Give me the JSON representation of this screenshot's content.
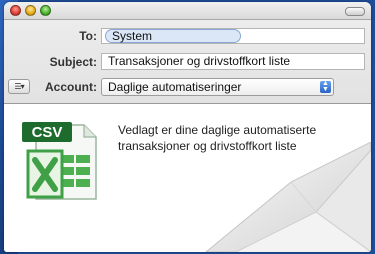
{
  "header": {
    "to_label": "To:",
    "to_recipient": "System",
    "subject_label": "Subject:",
    "subject_value": "Transaksjoner og drivstoffkort liste",
    "account_label": "Account:",
    "account_value": "Daglige automatiseringer"
  },
  "attachment": {
    "icon_text": "CSV"
  },
  "message": {
    "text": "Vedlagt er dine daglige automatiserte transaksjoner og drivstoffkort liste"
  },
  "colors": {
    "desktop_blue": "#1f4f9c",
    "excel_green": "#3fa047",
    "csv_badge": "#1e6b2e",
    "select_blue": "#2a63c6"
  },
  "icons": [
    "close-light",
    "minimize-light",
    "zoom-light",
    "toolbar-toggle",
    "list-menu-icon",
    "select-arrow-icon",
    "csv-excel-icon",
    "envelope-icon"
  ]
}
